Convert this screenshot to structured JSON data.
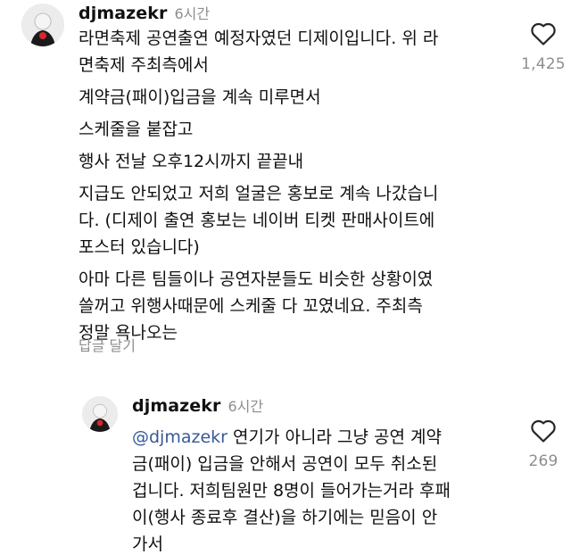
{
  "comments": [
    {
      "username": "djmazekr",
      "time": "6시간",
      "lines": [
        "라면축제 공연출연 예정자였던 디제이입니다. 위 라",
        "면축제 주최측에서",
        "계약금(패이)입금을 계속 미루면서",
        "스케줄을 붙잡고",
        "행사 전날 오후12시까지 끝끝내",
        "지급도 안되었고 저희 얼굴은 홍보로 계속 나갔습니",
        "다. (디제이 출연 홍보는 네이버 티켓 판매사이트에",
        "포스터 있습니다)",
        " 아마 다른 팀들이나 공연자분들도 비슷한 상황이였",
        "쓸꺼고 위행사때문에 스케줄 다 꼬였네요. 주최측",
        "정말 욕나오는"
      ],
      "likes": "1,425",
      "reply_label": "답글 달기"
    },
    {
      "username": "djmazekr",
      "time": "6시간",
      "mention": "@djmazekr",
      "first_line_rest": " 연기가 아니라 그냥 공연 계약",
      "lines": [
        "금(패이) 입금을 안해서 공연이 모두 취소된",
        "겁니다. 저희팀원만 8명이 들어가는거라 후패",
        "이(행사 종료후 결산)을 하기에는 믿음이 안",
        "가서"
      ],
      "likes": "269"
    }
  ],
  "colors": {
    "text": "#111111",
    "meta": "#8e8e8e",
    "mention": "#385898",
    "avatar_accent": "#d8262a"
  },
  "icons": [
    "avatar",
    "heart-outline-icon"
  ]
}
